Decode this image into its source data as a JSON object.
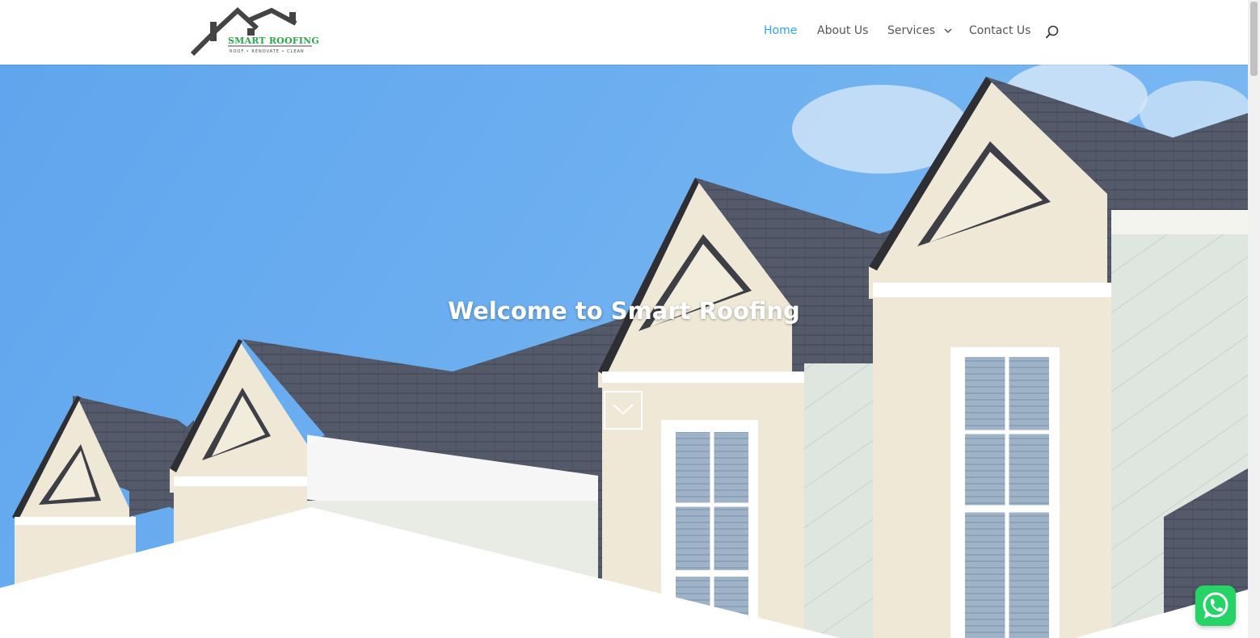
{
  "brand": {
    "name": "SMART ROOFING",
    "tagline": "ROOF • RENOVATE • CLEAN",
    "color": "#2aa84a"
  },
  "nav": {
    "items": [
      {
        "label": "Home",
        "active": true
      },
      {
        "label": "About Us",
        "active": false
      },
      {
        "label": "Services",
        "active": false,
        "has_dropdown": true
      },
      {
        "label": "Contact Us",
        "active": false
      }
    ],
    "active_color": "#2ea3f2"
  },
  "hero": {
    "title": "Welcome to Smart Roofing"
  },
  "icons": {
    "search": "search-icon",
    "scroll_down": "chevron-down-icon",
    "whatsapp": "whatsapp-icon",
    "dropdown": "chevron-down-icon"
  }
}
